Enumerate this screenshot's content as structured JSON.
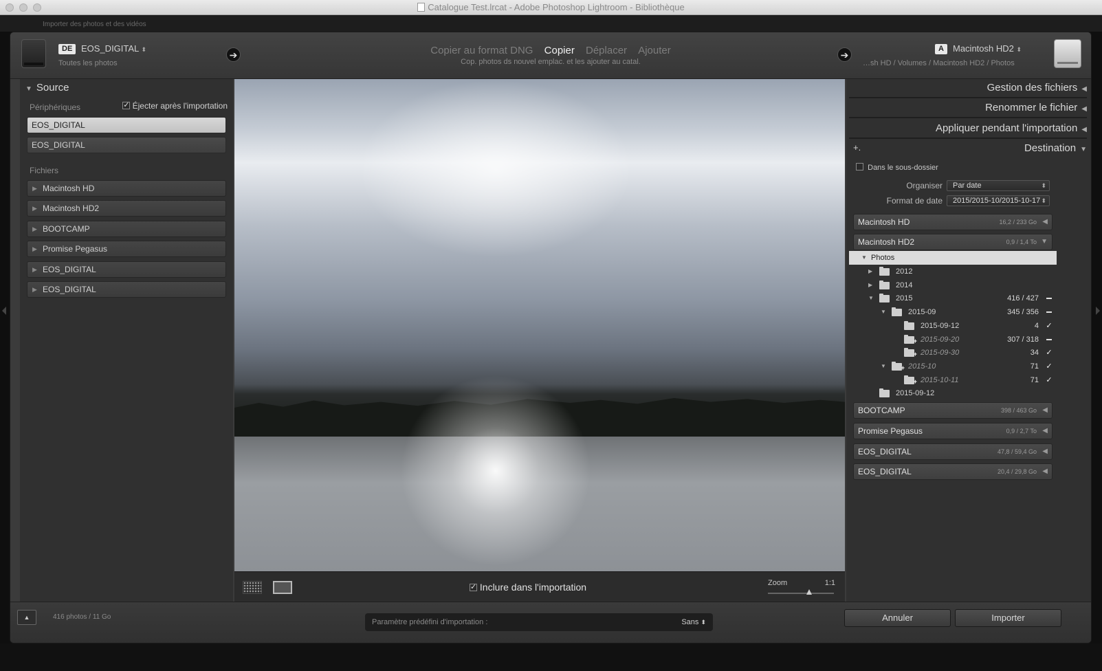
{
  "window": {
    "title": "Catalogue Test.lrcat - Adobe Photoshop Lightroom - Bibliothèque"
  },
  "subbar": {
    "text": "Importer des photos et des vidéos"
  },
  "header": {
    "source_badge": "DE",
    "source_name": "EOS_DIGITAL",
    "source_sub": "Toutes les photos",
    "modes": [
      "Copier au format DNG",
      "Copier",
      "Déplacer",
      "Ajouter"
    ],
    "active_mode": "Copier",
    "mode_desc": "Cop. photos ds nouvel emplac. et les ajouter au catal.",
    "dest_badge": "A",
    "dest_name": "Macintosh HD2",
    "dest_path": "…sh HD / Volumes / Macintosh HD2 / Photos"
  },
  "source": {
    "title": "Source",
    "devices_label": "Périphériques",
    "eject_label": "Éjecter après l'importation",
    "eject_checked": true,
    "devices": [
      "EOS_DIGITAL",
      "EOS_DIGITAL"
    ],
    "files_label": "Fichiers",
    "files": [
      "Macintosh HD",
      "Macintosh HD2",
      "BOOTCAMP",
      "Promise Pegasus",
      "EOS_DIGITAL",
      "EOS_DIGITAL"
    ]
  },
  "view": {
    "include_label": "Inclure dans l'importation",
    "include_checked": true,
    "zoom_label": "Zoom",
    "zoom_value": "1:1"
  },
  "right": {
    "sections": [
      "Gestion des fichiers",
      "Renommer le fichier",
      "Appliquer pendant l'importation"
    ],
    "destination_title": "Destination",
    "add_icon": "+.",
    "subfolder_label": "Dans le sous-dossier",
    "organize_label": "Organiser",
    "organize_value": "Par date",
    "dateformat_label": "Format de date",
    "dateformat_value": "2015/2015-10/2015-10-17",
    "volumes_top": [
      {
        "name": "Macintosh HD",
        "cap": "16,2 / 233 Go"
      },
      {
        "name": "Macintosh HD2",
        "cap": "0,9 / 1,4 To"
      }
    ],
    "tree": [
      {
        "label": "Photos"
      },
      {
        "label": "2012"
      },
      {
        "label": "2014"
      },
      {
        "label": "2015",
        "count": "416 / 427"
      },
      {
        "label": "2015-09",
        "count": "345 / 356"
      },
      {
        "label": "2015-09-12",
        "count": "4"
      },
      {
        "label": "2015-09-20",
        "count": "307 / 318"
      },
      {
        "label": "2015-09-30",
        "count": "34"
      },
      {
        "label": "2015-10",
        "count": "71"
      },
      {
        "label": "2015-10-11",
        "count": "71"
      },
      {
        "label": "2015-09-12"
      }
    ],
    "volumes_bottom": [
      {
        "name": "BOOTCAMP",
        "cap": "398 / 463 Go"
      },
      {
        "name": "Promise Pegasus",
        "cap": "0,9 / 2,7 To"
      },
      {
        "name": "EOS_DIGITAL",
        "cap": "47,8 / 59,4 Go"
      },
      {
        "name": "EOS_DIGITAL",
        "cap": "20,4 / 29,8 Go"
      }
    ]
  },
  "footer": {
    "photo_count": "416 photos / 11 Go",
    "preset_label": "Paramètre prédéfini d'importation :",
    "preset_value": "Sans",
    "cancel_label": "Annuler",
    "import_label": "Importer"
  }
}
